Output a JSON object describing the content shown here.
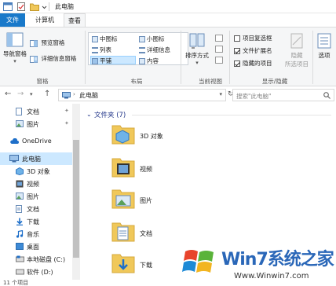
{
  "window": {
    "title": "此电脑"
  },
  "ribbon_tabs": [
    {
      "label": "文件"
    },
    {
      "label": "计算机"
    },
    {
      "label": "查看"
    }
  ],
  "ribbon": {
    "pane_group": {
      "label": "窗格",
      "nav_pane": "导航窗格",
      "preview_pane": "预览窗格",
      "details_pane": "详细信息窗格"
    },
    "layout_group": {
      "label": "布局",
      "items": [
        "中图标",
        "小图标",
        "列表",
        "详细信息",
        "平铺",
        "内容"
      ]
    },
    "current_view_group": {
      "label": "当前视图",
      "sort_by": "排序方式"
    },
    "show_hide_group": {
      "label": "显示/隐藏",
      "item_checkboxes": {
        "label": "项目复选框",
        "checked": false
      },
      "file_extensions": {
        "label": "文件扩展名",
        "checked": true
      },
      "hidden_items": {
        "label": "隐藏的项目",
        "checked": true
      },
      "hide_selected_1": "隐藏",
      "hide_selected_2": "所选项目"
    },
    "options": "选项"
  },
  "address": {
    "path": "此电脑",
    "search_placeholder": "搜索\"此电脑\""
  },
  "nav": {
    "items": [
      {
        "label": "文档",
        "icon": "document-icon"
      },
      {
        "label": "图片",
        "icon": "picture-icon"
      },
      {
        "label": "OneDrive",
        "icon": "cloud-icon"
      },
      {
        "label": "此电脑",
        "icon": "computer-icon"
      },
      {
        "label": "3D 对象",
        "icon": "3d-objects-icon"
      },
      {
        "label": "视频",
        "icon": "video-icon"
      },
      {
        "label": "图片",
        "icon": "picture-icon"
      },
      {
        "label": "文档",
        "icon": "document-icon"
      },
      {
        "label": "下载",
        "icon": "download-icon"
      },
      {
        "label": "音乐",
        "icon": "music-icon"
      },
      {
        "label": "桌面",
        "icon": "desktop-icon"
      },
      {
        "label": "本地磁盘 (C:)",
        "icon": "drive-c-icon"
      },
      {
        "label": "软件 (D:)",
        "icon": "drive-d-icon"
      }
    ]
  },
  "main": {
    "group_header": "文件夹 (7)",
    "folders": [
      {
        "label": "3D 对象"
      },
      {
        "label": "视频"
      },
      {
        "label": "图片"
      },
      {
        "label": "文档"
      },
      {
        "label": "下载"
      }
    ]
  },
  "status": {
    "count": "11 个项目"
  },
  "watermark": {
    "brand": "Win7系统之家",
    "url": "Www.Winwin7.com"
  },
  "colors": {
    "accent": "#1979ca",
    "selection": "#cce8ff",
    "folder": "#f0c85a"
  }
}
